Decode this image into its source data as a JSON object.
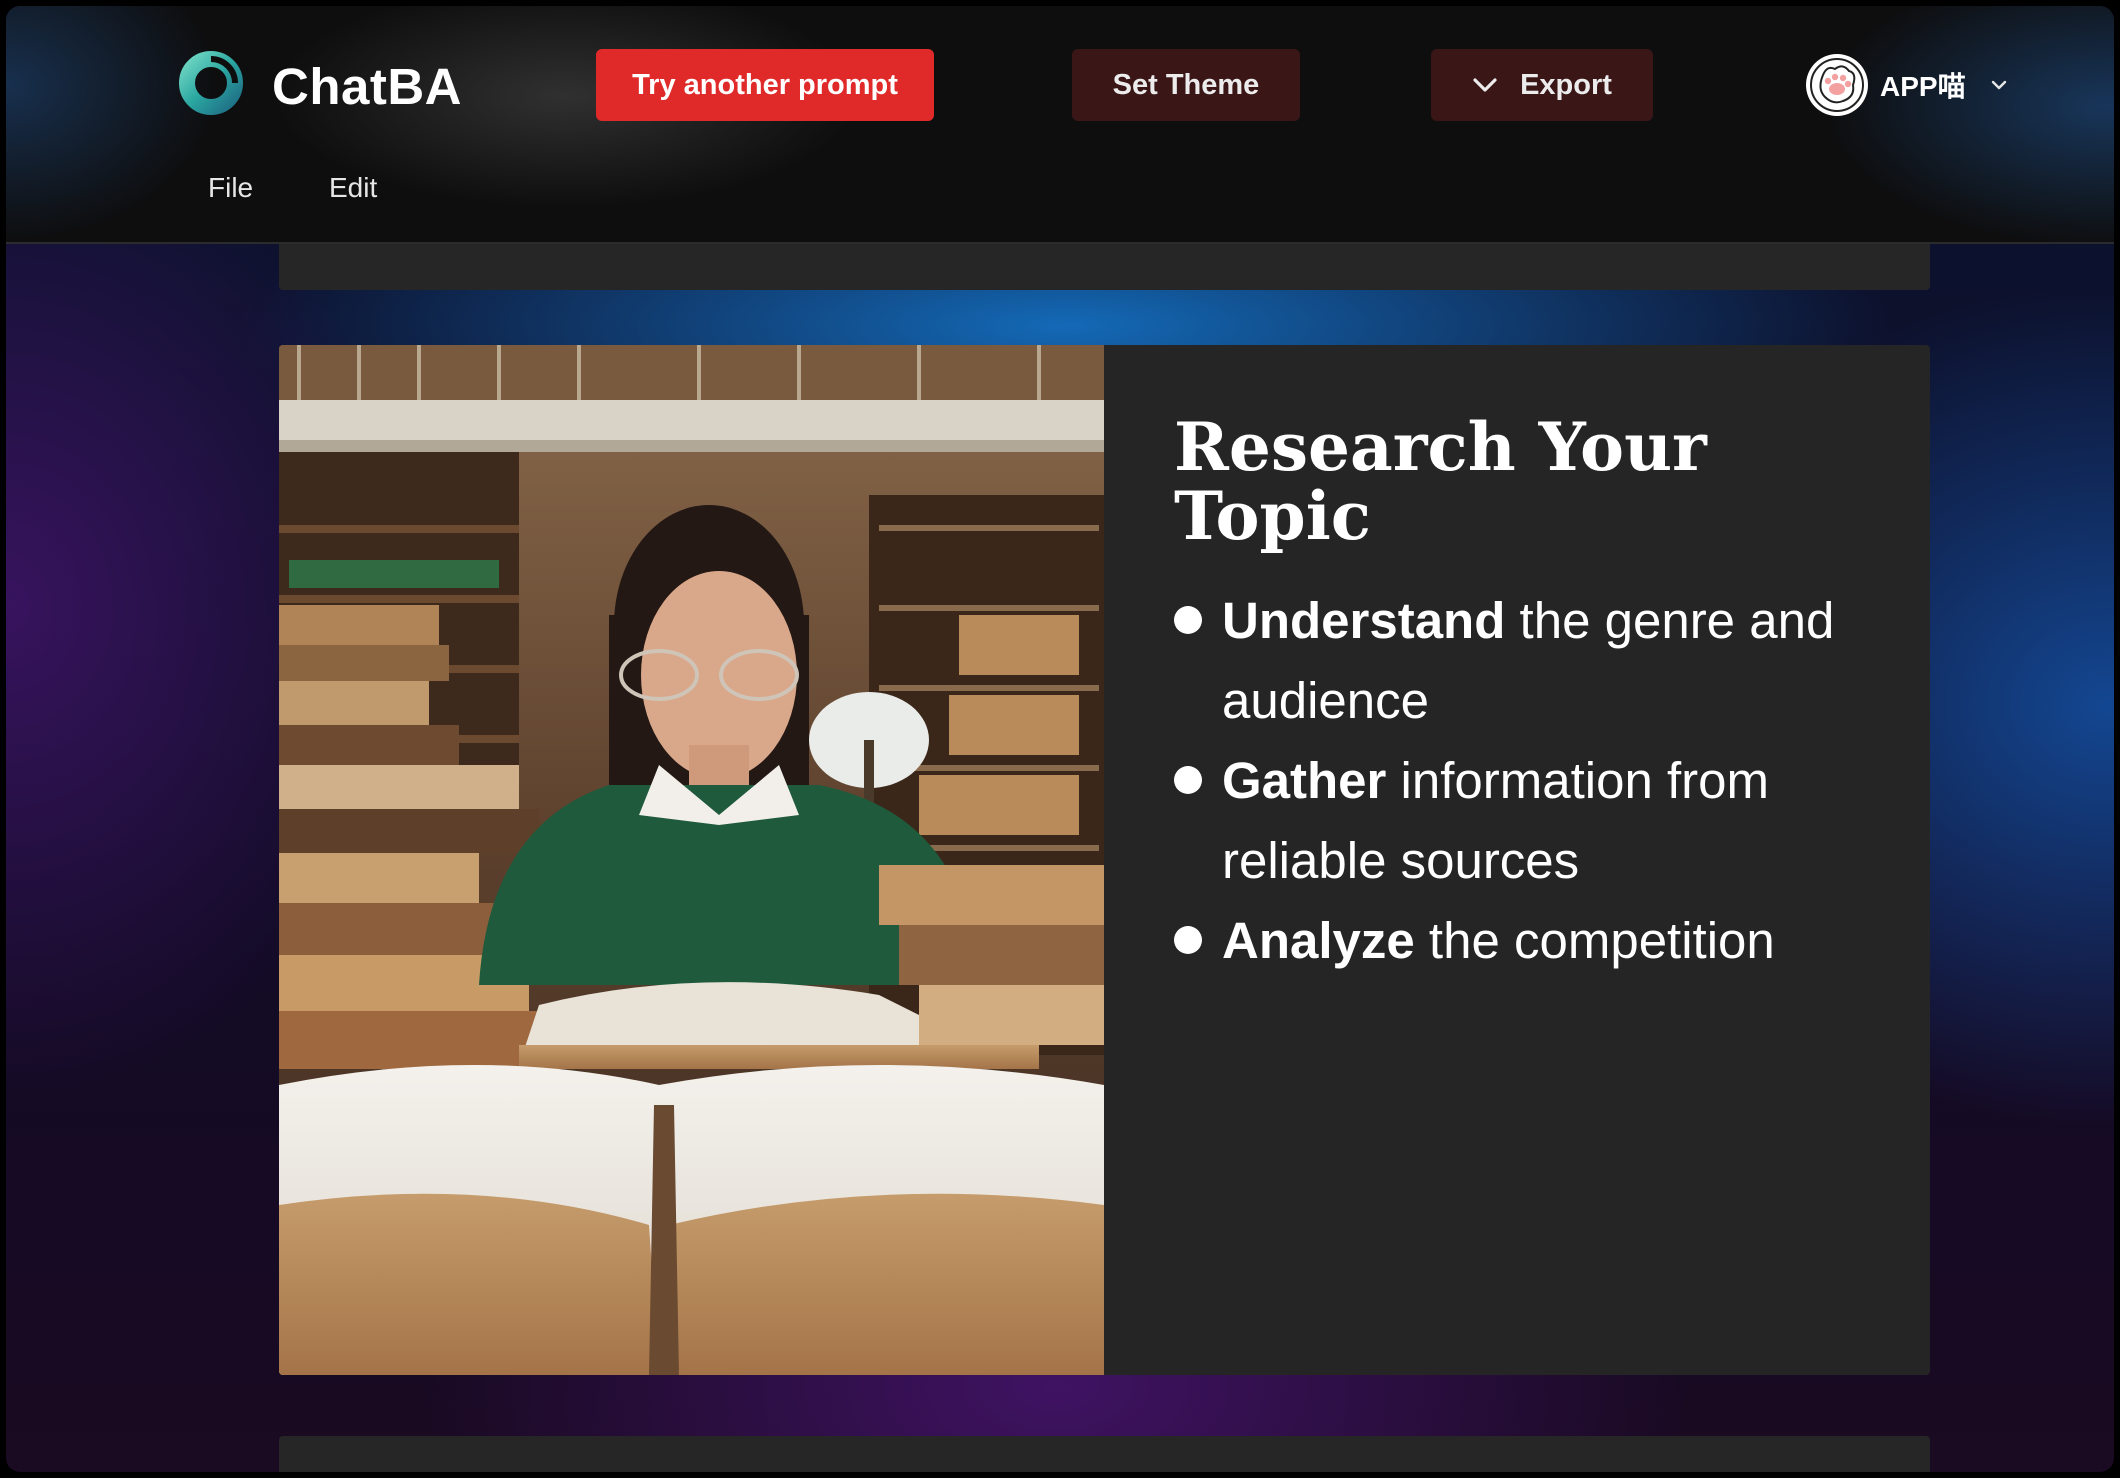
{
  "app": {
    "brand": "ChatBA"
  },
  "toolbar": {
    "try_label": "Try another prompt",
    "theme_label": "Set Theme",
    "export_label": "Export"
  },
  "user": {
    "name": "APP喵"
  },
  "menu": {
    "file": "File",
    "edit": "Edit"
  },
  "slide": {
    "title": "Research Your Topic",
    "bullets": [
      {
        "keyword": "Understand",
        "rest": " the genre and audience"
      },
      {
        "keyword": "Gather",
        "rest": " information from reliable sources"
      },
      {
        "keyword": "Analyze",
        "rest": " the competition"
      }
    ]
  },
  "colors": {
    "accent_red": "#e02a2a",
    "dark_button": "#3a1616",
    "slide_bg": "#252526",
    "logo_teal": "#2bb3a8"
  },
  "icons": {
    "logo": "chatba-ring-logo-icon",
    "export_chevron": "chevron-down-icon",
    "user_chevron": "chevron-down-icon",
    "avatar": "cat-paw-avatar-icon"
  }
}
